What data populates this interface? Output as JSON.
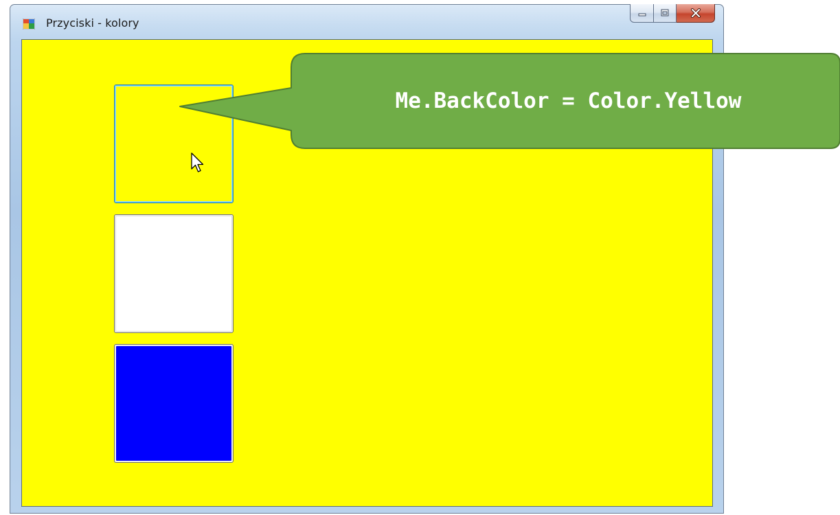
{
  "window": {
    "title": "Przyciski - kolory",
    "icon": "windows-form-icon",
    "caption_buttons": {
      "minimize": "minimize-icon",
      "maximize": "maximize-icon",
      "close": "close-icon"
    }
  },
  "form": {
    "back_color": "#ffff00",
    "buttons": [
      {
        "name": "yellow",
        "color": "#ffff00",
        "focused": true
      },
      {
        "name": "white",
        "color": "#ffffff",
        "focused": false
      },
      {
        "name": "blue",
        "color": "#0000ff",
        "focused": false
      }
    ]
  },
  "callout": {
    "text": "Me.BackColor = Color.Yellow",
    "color": "#70ad47"
  },
  "cursor": "arrow-cursor-icon"
}
